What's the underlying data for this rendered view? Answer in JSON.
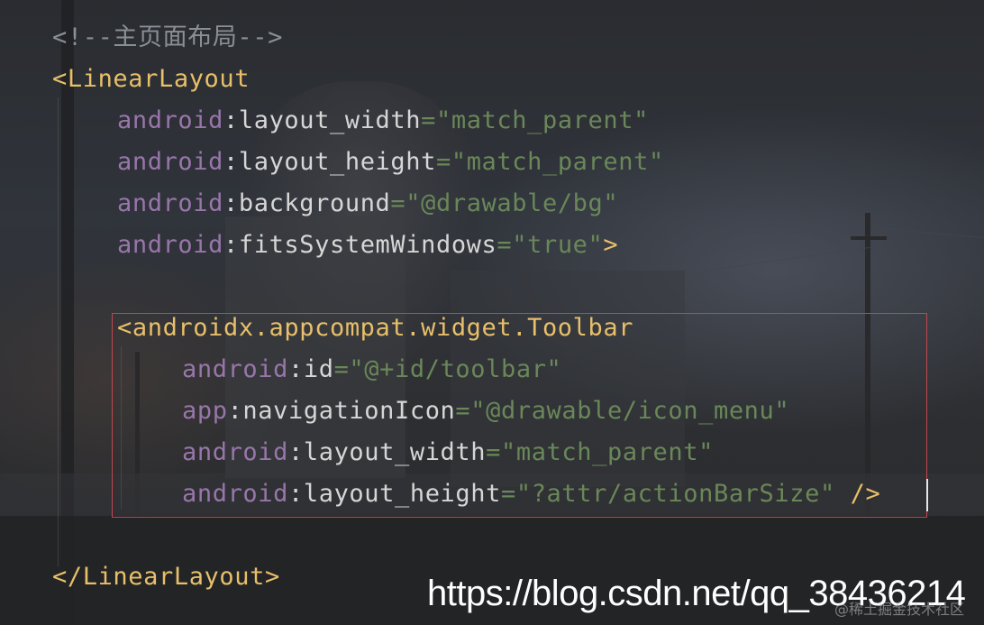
{
  "editor": {
    "lines": [
      {
        "parts": [
          {
            "t": "<!--主页面布局-->",
            "c": "comment"
          }
        ]
      },
      {
        "parts": [
          {
            "t": "<LinearLayout",
            "c": "tag"
          }
        ]
      },
      {
        "parts": [
          {
            "t": "android",
            "c": "ns"
          },
          {
            "t": ":layout_width",
            "c": "attr"
          },
          {
            "t": "=\"match_parent\"",
            "c": "val"
          }
        ]
      },
      {
        "parts": [
          {
            "t": "android",
            "c": "ns"
          },
          {
            "t": ":layout_height",
            "c": "attr"
          },
          {
            "t": "=\"match_parent\"",
            "c": "val"
          }
        ]
      },
      {
        "parts": [
          {
            "t": "android",
            "c": "ns"
          },
          {
            "t": ":background",
            "c": "attr"
          },
          {
            "t": "=\"@drawable/bg\"",
            "c": "val"
          }
        ]
      },
      {
        "parts": [
          {
            "t": "android",
            "c": "ns"
          },
          {
            "t": ":fitsSystemWindows",
            "c": "attr"
          },
          {
            "t": "=\"true\"",
            "c": "val"
          },
          {
            "t": ">",
            "c": "tag"
          }
        ]
      },
      {
        "parts": []
      },
      {
        "parts": [
          {
            "t": "<androidx.appcompat.widget.Toolbar",
            "c": "tag"
          }
        ]
      },
      {
        "parts": [
          {
            "t": "android",
            "c": "ns"
          },
          {
            "t": ":id",
            "c": "attr"
          },
          {
            "t": "=\"@+id/toolbar\"",
            "c": "val"
          }
        ]
      },
      {
        "parts": [
          {
            "t": "app",
            "c": "ns"
          },
          {
            "t": ":navigationIcon",
            "c": "attr"
          },
          {
            "t": "=\"@drawable/icon_menu\"",
            "c": "val"
          }
        ]
      },
      {
        "parts": [
          {
            "t": "android",
            "c": "ns"
          },
          {
            "t": ":layout_width",
            "c": "attr"
          },
          {
            "t": "=\"match_parent\"",
            "c": "val"
          }
        ]
      },
      {
        "parts": [
          {
            "t": "android",
            "c": "ns"
          },
          {
            "t": ":layout_height",
            "c": "attr"
          },
          {
            "t": "=\"?attr/actionBarSize\"",
            "c": "val"
          },
          {
            "t": " />",
            "c": "tag"
          }
        ]
      },
      {
        "parts": []
      },
      {
        "parts": [
          {
            "t": "</LinearLayout>",
            "c": "tag"
          }
        ]
      }
    ]
  },
  "watermark": {
    "url": "https://blog.csdn.net/qq_38436214",
    "community": "@稀土掘金技术社区"
  },
  "colors": {
    "comment": "#8a8f96",
    "tag": "#e8bf6a",
    "namespace": "#9876aa",
    "attribute": "#d6d6d6",
    "value": "#6a8759",
    "highlight_border": "#c2474e"
  }
}
